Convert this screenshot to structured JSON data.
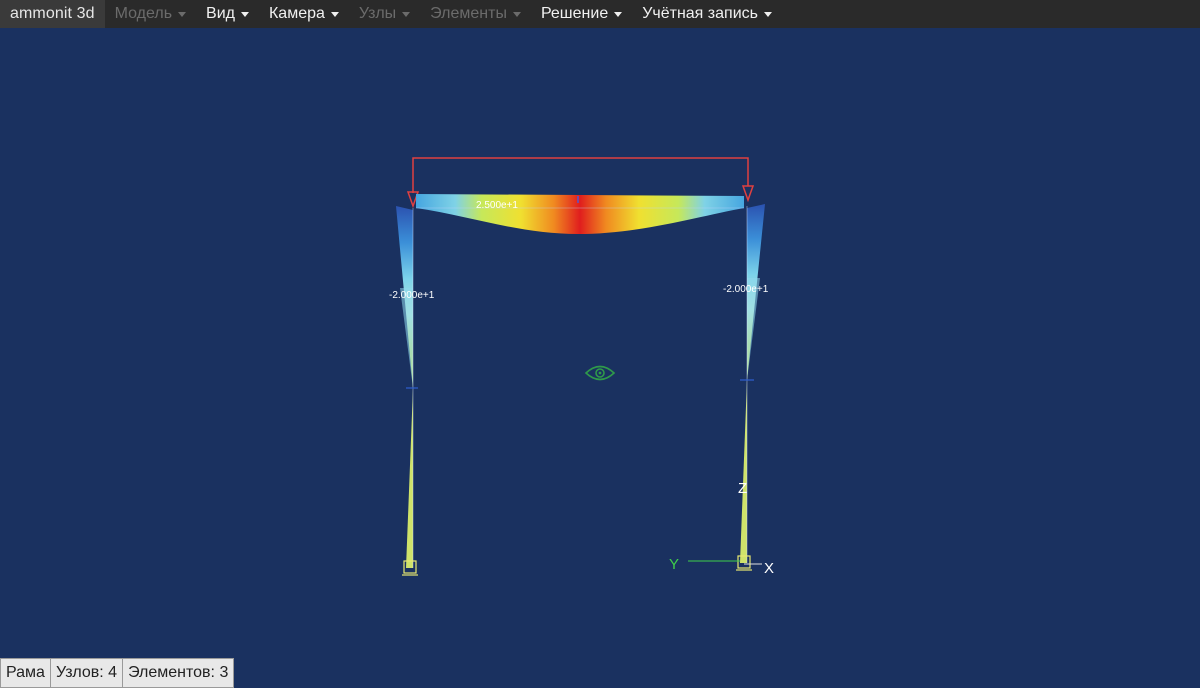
{
  "menubar": {
    "brand": "ammonit 3d",
    "items": [
      {
        "label": "Модель",
        "enabled": false
      },
      {
        "label": "Вид",
        "enabled": true
      },
      {
        "label": "Камера",
        "enabled": true
      },
      {
        "label": "Узлы",
        "enabled": false
      },
      {
        "label": "Элементы",
        "enabled": false
      },
      {
        "label": "Решение",
        "enabled": true
      },
      {
        "label": "Учётная запись",
        "enabled": true
      }
    ]
  },
  "viewport": {
    "labels": {
      "beam_value": "2.500e+1",
      "left_column_value": "-2.000e+1",
      "right_column_value": "-2.000e+1"
    },
    "axes": {
      "y": "Y",
      "z": "Z",
      "x": "X"
    },
    "colors": {
      "background": "#1a3160",
      "load": "#e04040",
      "axis_y": "#3ecf4a",
      "axis_x": "#ffffff",
      "gizmo": "#2f9a4a"
    }
  },
  "statusbar": {
    "model_name": "Рама",
    "nodes": "Узлов: 4",
    "elements": "Элементов: 3"
  }
}
